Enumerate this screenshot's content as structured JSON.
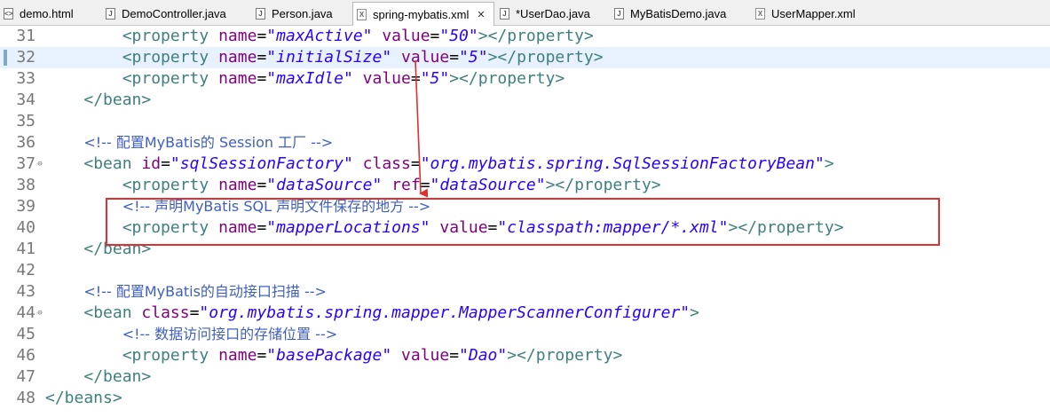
{
  "tabs": [
    {
      "label": "demo.html",
      "icon": "html-file-icon",
      "active": false
    },
    {
      "label": "DemoController.java",
      "icon": "java-file-icon",
      "active": false
    },
    {
      "label": "Person.java",
      "icon": "java-file-icon",
      "active": false
    },
    {
      "label": "spring-mybatis.xml",
      "icon": "xml-file-icon",
      "active": true
    },
    {
      "label": "*UserDao.java",
      "icon": "java-file-icon",
      "active": false
    },
    {
      "label": "MyBatisDemo.java",
      "icon": "java-file-icon",
      "active": false
    },
    {
      "label": "UserMapper.xml",
      "icon": "xml-file-icon",
      "active": false
    }
  ],
  "editor": {
    "lines": [
      {
        "num": "31",
        "tokens": [
          [
            "sp",
            "        "
          ],
          [
            "tag",
            "<property "
          ],
          [
            "attr",
            "name"
          ],
          [
            "eq",
            "="
          ],
          [
            "val",
            "\"maxActive\""
          ],
          [
            "sp",
            " "
          ],
          [
            "attr",
            "value"
          ],
          [
            "eq",
            "="
          ],
          [
            "val",
            "\"50\""
          ],
          [
            "tag",
            "></property>"
          ]
        ]
      },
      {
        "num": "32",
        "tokens": [
          [
            "sp",
            "        "
          ],
          [
            "tag",
            "<property "
          ],
          [
            "attr",
            "name"
          ],
          [
            "eq",
            "="
          ],
          [
            "val",
            "\"initialSize\""
          ],
          [
            "sp",
            " "
          ],
          [
            "attr",
            "value"
          ],
          [
            "eq",
            "="
          ],
          [
            "val",
            "\"5\""
          ],
          [
            "tag",
            "></property>"
          ]
        ]
      },
      {
        "num": "33",
        "tokens": [
          [
            "sp",
            "        "
          ],
          [
            "tag",
            "<property "
          ],
          [
            "attr",
            "name"
          ],
          [
            "eq",
            "="
          ],
          [
            "val",
            "\"maxIdle\""
          ],
          [
            "sp",
            " "
          ],
          [
            "attr",
            "value"
          ],
          [
            "eq",
            "="
          ],
          [
            "val",
            "\"5\""
          ],
          [
            "tag",
            "></property>"
          ]
        ]
      },
      {
        "num": "34",
        "tokens": [
          [
            "sp",
            "    "
          ],
          [
            "tag",
            "</bean>"
          ]
        ]
      },
      {
        "num": "35",
        "tokens": []
      },
      {
        "num": "36",
        "tokens": [
          [
            "sp",
            "    "
          ],
          [
            "com",
            "<!-- 配置MyBatis的 Session 工厂 -->"
          ]
        ]
      },
      {
        "num": "37",
        "fold": "⊖",
        "tokens": [
          [
            "sp",
            "    "
          ],
          [
            "tag",
            "<bean "
          ],
          [
            "attr",
            "id"
          ],
          [
            "eq",
            "="
          ],
          [
            "val",
            "\"sqlSessionFactory\""
          ],
          [
            "sp",
            " "
          ],
          [
            "attr",
            "class"
          ],
          [
            "eq",
            "="
          ],
          [
            "val",
            "\"org.mybatis.spring.SqlSessionFactoryBean\""
          ],
          [
            "tag",
            ">"
          ]
        ]
      },
      {
        "num": "38",
        "tokens": [
          [
            "sp",
            "        "
          ],
          [
            "tag",
            "<property "
          ],
          [
            "attr",
            "name"
          ],
          [
            "eq",
            "="
          ],
          [
            "val",
            "\"dataSource\""
          ],
          [
            "sp",
            " "
          ],
          [
            "attr",
            "ref"
          ],
          [
            "eq",
            "="
          ],
          [
            "val",
            "\"dataSource\""
          ],
          [
            "tag",
            "></property>"
          ]
        ]
      },
      {
        "num": "39",
        "tokens": [
          [
            "sp",
            "        "
          ],
          [
            "com",
            "<!-- 声明MyBatis SQL 声明文件保存的地方 -->"
          ]
        ]
      },
      {
        "num": "40",
        "tokens": [
          [
            "sp",
            "        "
          ],
          [
            "tag",
            "<property "
          ],
          [
            "attr",
            "name"
          ],
          [
            "eq",
            "="
          ],
          [
            "val",
            "\"mapperLocations\""
          ],
          [
            "sp",
            " "
          ],
          [
            "attr",
            "value"
          ],
          [
            "eq",
            "="
          ],
          [
            "val",
            "\"classpath:mapper/*.xml\""
          ],
          [
            "tag",
            "></property>"
          ]
        ]
      },
      {
        "num": "41",
        "tokens": [
          [
            "sp",
            "    "
          ],
          [
            "tag",
            "</bean>"
          ]
        ]
      },
      {
        "num": "42",
        "tokens": []
      },
      {
        "num": "43",
        "tokens": [
          [
            "sp",
            "    "
          ],
          [
            "com",
            "<!-- 配置MyBatis的自动接口扫描 -->"
          ]
        ]
      },
      {
        "num": "44",
        "fold": "⊖",
        "tokens": [
          [
            "sp",
            "    "
          ],
          [
            "tag",
            "<bean "
          ],
          [
            "attr",
            "class"
          ],
          [
            "eq",
            "="
          ],
          [
            "val",
            "\"org.mybatis.spring.mapper.MapperScannerConfigurer\""
          ],
          [
            "tag",
            ">"
          ]
        ]
      },
      {
        "num": "45",
        "tokens": [
          [
            "sp",
            "        "
          ],
          [
            "com",
            "<!-- 数据访问接口的存储位置 -->"
          ]
        ]
      },
      {
        "num": "46",
        "tokens": [
          [
            "sp",
            "        "
          ],
          [
            "tag",
            "<property "
          ],
          [
            "attr",
            "name"
          ],
          [
            "eq",
            "="
          ],
          [
            "val",
            "\"basePackage\""
          ],
          [
            "sp",
            " "
          ],
          [
            "attr",
            "value"
          ],
          [
            "eq",
            "="
          ],
          [
            "val",
            "\"Dao\""
          ],
          [
            "tag",
            "></property>"
          ]
        ]
      },
      {
        "num": "47",
        "tokens": [
          [
            "sp",
            "    "
          ],
          [
            "tag",
            "</bean>"
          ]
        ]
      },
      {
        "num": "48",
        "tokens": [
          [
            "tag",
            "</beans>"
          ]
        ]
      }
    ],
    "current_line": "32"
  },
  "colors": {
    "tag": "#3f7f7f",
    "attr": "#7f007f",
    "value": "#2a00ff",
    "comment": "#3f5fbf",
    "current_line_bg": "#e8f2fe",
    "annotation": "#e03030"
  }
}
